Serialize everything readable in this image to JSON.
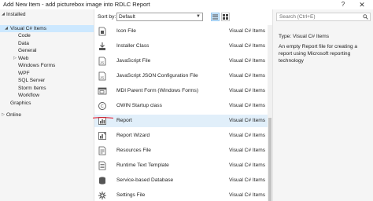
{
  "window": {
    "title": "Add New Item - add picturebox image into RDLC Report",
    "help_label": "?",
    "close_label": "✕"
  },
  "tree": {
    "installed": "Installed",
    "visual_csharp": "Visual C# Items",
    "code": "Code",
    "data": "Data",
    "general": "General",
    "web": "Web",
    "windows_forms": "Windows Forms",
    "wpf": "WPF",
    "sql_server": "SQL Server",
    "storm_items": "Storm Items",
    "workflow": "Workflow",
    "graphics": "Graphics",
    "online": "Online"
  },
  "toolbar": {
    "sort_label": "Sort by:",
    "sort_value": "Default"
  },
  "items": [
    {
      "name": "Icon File",
      "type": "Visual C# Items",
      "icon": "icon-file-icon"
    },
    {
      "name": "Installer Class",
      "type": "Visual C# Items",
      "icon": "installer-class-icon"
    },
    {
      "name": "JavaScript File",
      "type": "Visual C# Items",
      "icon": "javascript-file-icon"
    },
    {
      "name": "JavaScript JSON Configuration File",
      "type": "Visual C# Items",
      "icon": "json-config-icon"
    },
    {
      "name": "MDI Parent Form (Windows Forms)",
      "type": "Visual C# Items",
      "icon": "mdi-form-icon"
    },
    {
      "name": "OWIN Startup class",
      "type": "Visual C# Items",
      "icon": "owin-startup-icon"
    },
    {
      "name": "Report",
      "type": "Visual C# Items",
      "icon": "report-icon"
    },
    {
      "name": "Report Wizard",
      "type": "Visual C# Items",
      "icon": "report-wizard-icon"
    },
    {
      "name": "Resources File",
      "type": "Visual C# Items",
      "icon": "resources-file-icon"
    },
    {
      "name": "Runtime Text Template",
      "type": "Visual C# Items",
      "icon": "text-template-icon"
    },
    {
      "name": "Service-based Database",
      "type": "Visual C# Items",
      "icon": "database-icon"
    },
    {
      "name": "Settings File",
      "type": "Visual C# Items",
      "icon": "settings-file-icon"
    }
  ],
  "details": {
    "search_placeholder": "Search (Ctrl+E)",
    "type_label": "Type:",
    "type_value": "Visual C# Items",
    "description": "An empty Report file for creating a report using Microsoft reporting technology"
  },
  "colors": {
    "selection": "#cce8ff",
    "item_selected": "#e1effa",
    "annotation_underline": "#e81123"
  }
}
